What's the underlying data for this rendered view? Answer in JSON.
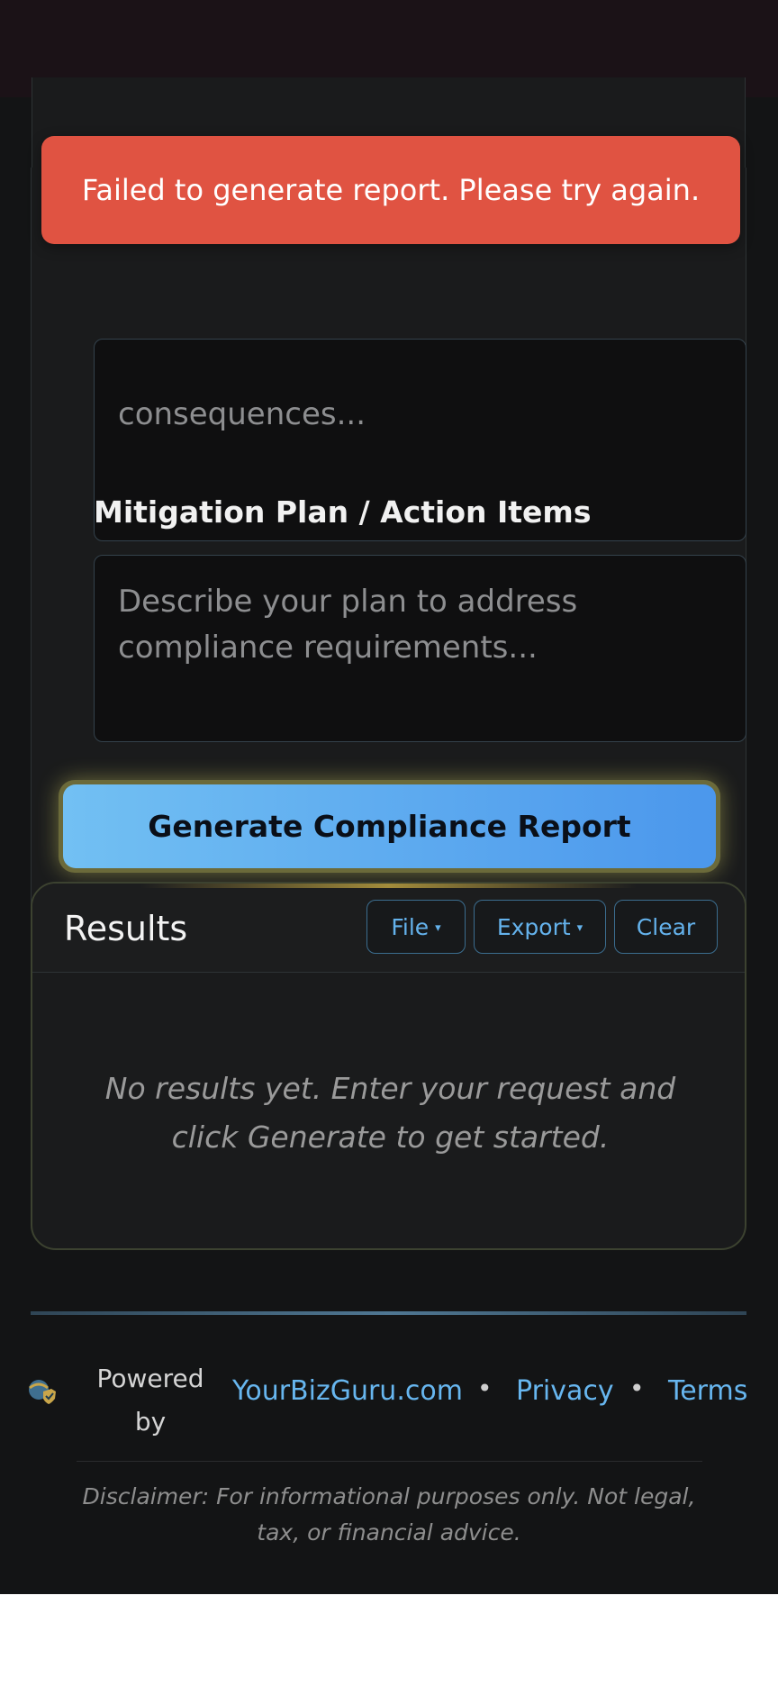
{
  "toast": {
    "message": "Failed to generate report. Please try again."
  },
  "form": {
    "impact_placeholder_visible": "consequences...",
    "mitigation_label": "Mitigation Plan / Action Items",
    "mitigation_placeholder": "Describe your plan to address compliance requirements...",
    "generate_label": "Generate Compliance Report"
  },
  "results": {
    "title": "Results",
    "file_label": "File",
    "export_label": "Export",
    "clear_label": "Clear",
    "caret": "▾",
    "empty_message": "No results yet. Enter your request and click Generate to get started."
  },
  "footer": {
    "powered_by": "Powered by",
    "site_link": "YourBizGuru.com",
    "separator": "•",
    "privacy_link": "Privacy",
    "terms_link": "Terms",
    "disclaimer": "Disclaimer: For informational purposes only. Not legal, tax, or financial advice.",
    "logo_icon": "shield-globe-icon"
  },
  "colors": {
    "toast_bg": "#e05342",
    "accent_blue": "#4b97ec",
    "link_blue": "#67b6ef",
    "page_bg": "#131415"
  }
}
